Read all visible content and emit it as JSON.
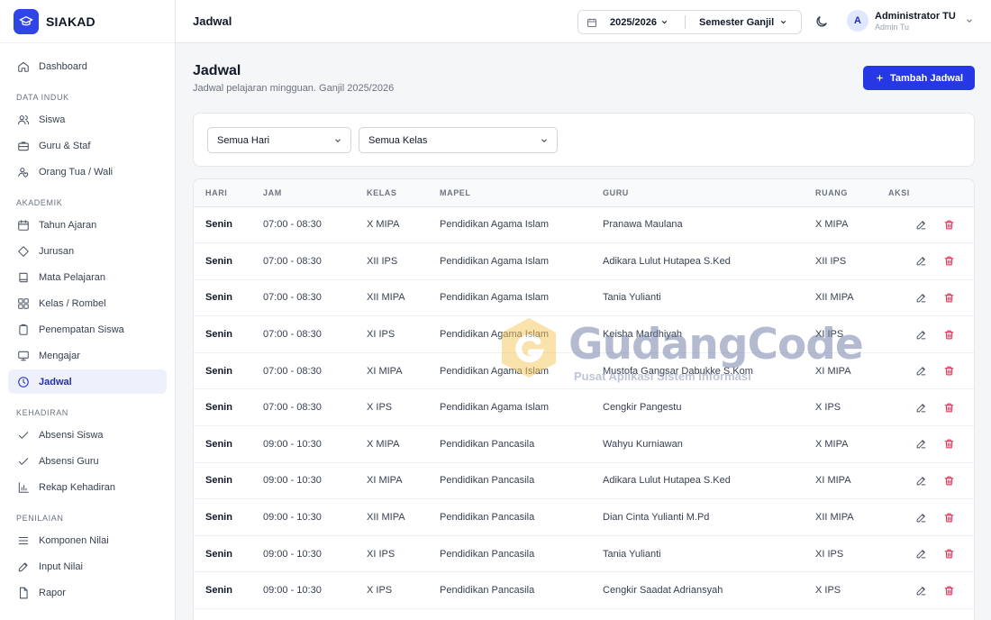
{
  "app": {
    "name": "SIAKAD"
  },
  "sidebar": {
    "items": [
      {
        "label": "Dashboard",
        "icon": "home-icon"
      }
    ],
    "sections": [
      {
        "title": "DATA INDUK",
        "items": [
          {
            "label": "Siswa",
            "icon": "users-icon"
          },
          {
            "label": "Guru & Staf",
            "icon": "briefcase-icon"
          },
          {
            "label": "Orang Tua / Wali",
            "icon": "user-heart-icon"
          }
        ]
      },
      {
        "title": "AKADEMIK",
        "items": [
          {
            "label": "Tahun Ajaran",
            "icon": "calendar-icon"
          },
          {
            "label": "Jurusan",
            "icon": "diamond-icon"
          },
          {
            "label": "Mata Pelajaran",
            "icon": "book-icon"
          },
          {
            "label": "Kelas / Rombel",
            "icon": "grid-icon"
          },
          {
            "label": "Penempatan Siswa",
            "icon": "clipboard-icon"
          },
          {
            "label": "Mengajar",
            "icon": "monitor-icon"
          },
          {
            "label": "Jadwal",
            "icon": "clock-icon",
            "active": true
          }
        ]
      },
      {
        "title": "KEHADIRAN",
        "items": [
          {
            "label": "Absensi Siswa",
            "icon": "check-icon"
          },
          {
            "label": "Absensi Guru",
            "icon": "check-icon"
          },
          {
            "label": "Rekap Kehadiran",
            "icon": "bar-chart-icon"
          }
        ]
      },
      {
        "title": "PENILAIAN",
        "items": [
          {
            "label": "Komponen Nilai",
            "icon": "list-icon"
          },
          {
            "label": "Input Nilai",
            "icon": "pencil-icon"
          },
          {
            "label": "Rapor",
            "icon": "file-icon"
          }
        ]
      }
    ]
  },
  "header": {
    "title": "Jadwal",
    "academic_year": "2025/2026",
    "semester": "Semester Ganjil",
    "user": {
      "initial": "A",
      "name": "Administrator TU",
      "role": "Admin Tu"
    }
  },
  "main": {
    "title": "Jadwal",
    "subtitle": "Jadwal pelajaran mingguan. Ganjil 2025/2026",
    "add_button": "Tambah Jadwal",
    "filters": {
      "day": "Semua Hari",
      "class": "Semua Kelas"
    },
    "table": {
      "columns": [
        "HARI",
        "JAM",
        "KELAS",
        "MAPEL",
        "GURU",
        "RUANG",
        "AKSI"
      ],
      "rows": [
        {
          "day": "Senin",
          "time": "07:00 - 08:30",
          "class": "X MIPA",
          "subject": "Pendidikan Agama Islam",
          "teacher": "Pranawa Maulana",
          "room": "X MIPA"
        },
        {
          "day": "Senin",
          "time": "07:00 - 08:30",
          "class": "XII IPS",
          "subject": "Pendidikan Agama Islam",
          "teacher": "Adikara Lulut Hutapea S.Ked",
          "room": "XII IPS"
        },
        {
          "day": "Senin",
          "time": "07:00 - 08:30",
          "class": "XII MIPA",
          "subject": "Pendidikan Agama Islam",
          "teacher": "Tania Yulianti",
          "room": "XII MIPA"
        },
        {
          "day": "Senin",
          "time": "07:00 - 08:30",
          "class": "XI IPS",
          "subject": "Pendidikan Agama Islam",
          "teacher": "Keisha Mardhiyah",
          "room": "XI IPS"
        },
        {
          "day": "Senin",
          "time": "07:00 - 08:30",
          "class": "XI MIPA",
          "subject": "Pendidikan Agama Islam",
          "teacher": "Mustofa Gangsar Dabukke S.Kom",
          "room": "XI MIPA"
        },
        {
          "day": "Senin",
          "time": "07:00 - 08:30",
          "class": "X IPS",
          "subject": "Pendidikan Agama Islam",
          "teacher": "Cengkir Pangestu",
          "room": "X IPS"
        },
        {
          "day": "Senin",
          "time": "09:00 - 10:30",
          "class": "X MIPA",
          "subject": "Pendidikan Pancasila",
          "teacher": "Wahyu Kurniawan",
          "room": "X MIPA"
        },
        {
          "day": "Senin",
          "time": "09:00 - 10:30",
          "class": "XI MIPA",
          "subject": "Pendidikan Pancasila",
          "teacher": "Adikara Lulut Hutapea S.Ked",
          "room": "XI MIPA"
        },
        {
          "day": "Senin",
          "time": "09:00 - 10:30",
          "class": "XII MIPA",
          "subject": "Pendidikan Pancasila",
          "teacher": "Dian Cinta Yulianti M.Pd",
          "room": "XII MIPA"
        },
        {
          "day": "Senin",
          "time": "09:00 - 10:30",
          "class": "XI IPS",
          "subject": "Pendidikan Pancasila",
          "teacher": "Tania Yulianti",
          "room": "XI IPS"
        },
        {
          "day": "Senin",
          "time": "09:00 - 10:30",
          "class": "X IPS",
          "subject": "Pendidikan Pancasila",
          "teacher": "Cengkir Saadat Adriansyah",
          "room": "X IPS"
        }
      ]
    }
  },
  "watermark": {
    "title": "GudangCode",
    "subtitle": "Pusat Aplikasi Sistem Informasi"
  },
  "colors": {
    "accent": "#2638e3",
    "delete": "#e11d48",
    "active_bg": "#eef1fb"
  }
}
